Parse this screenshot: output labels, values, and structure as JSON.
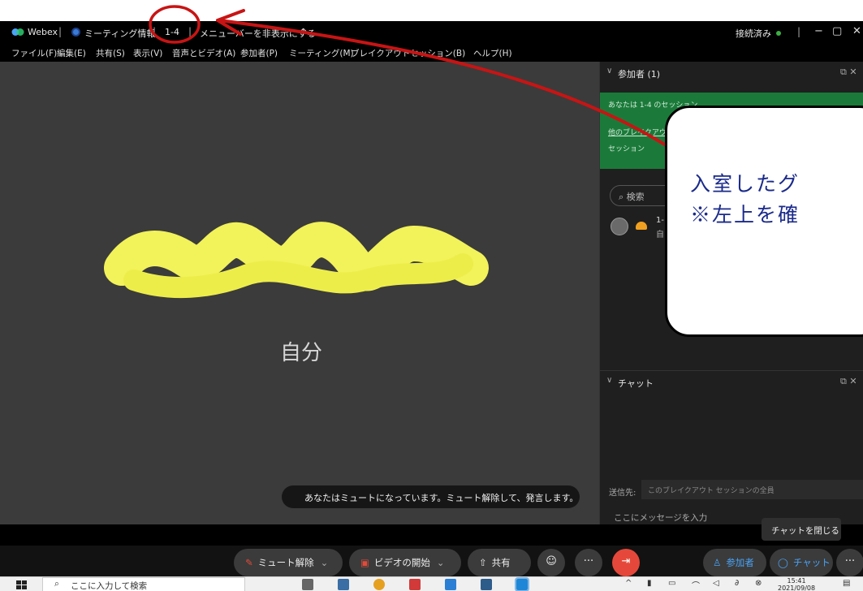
{
  "titlebar": {
    "app_name": "Webex",
    "meeting_info": "ミーティング情報",
    "session_name": "1-4",
    "hide_menu": "メニューバーを非表示にする",
    "connection_status": "接続済み"
  },
  "menubar": {
    "items": [
      "ファイル(F)",
      "編集(E)",
      "共有(S)",
      "表示(V)",
      "音声とビデオ(A)",
      "参加者(P)",
      "ミーティング(M)",
      "ブレイクアウトセッション(B)",
      "ヘルプ(H)"
    ]
  },
  "stage": {
    "self_label": "自分",
    "mute_banner": "あなたはミュートになっています。ミュート解除して、発言します。"
  },
  "participants_panel": {
    "title": "参加者 (1)",
    "session_notice": "あなたは 1-4 のセッション",
    "other_breakouts_link": "他のブレイクアウ",
    "session_item": "セッション",
    "search_placeholder": "検索",
    "participant_id": "1-",
    "participant_sub": "自"
  },
  "chat_panel": {
    "title": "チャット",
    "send_to_label": "送信先:",
    "send_to_value": "このブレイクアウト セッションの全員",
    "input_placeholder": "ここにメッセージを入力",
    "close_chat": "チャットを閉じる"
  },
  "controls": {
    "unmute": "ミュート解除",
    "start_video": "ビデオの開始",
    "share": "共有",
    "participants": "参加者",
    "chat": "チャット"
  },
  "taskbar": {
    "search_placeholder": "ここに入力して検索",
    "time": "15:41",
    "date": "2021/09/08"
  },
  "callout": {
    "line1": "入室したグ",
    "line2": "※左上を確"
  },
  "colors": {
    "annotation_red": "#c81414",
    "highlight_yellow": "#f2f25a",
    "session_green": "#1b7a3a",
    "end_call_red": "#e5483a"
  }
}
